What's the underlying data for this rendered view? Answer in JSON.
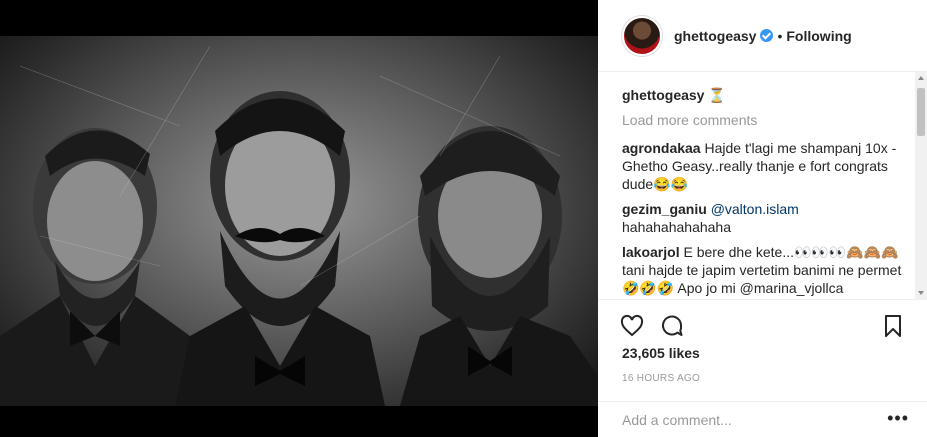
{
  "post": {
    "author": "ghettogeasy",
    "follow_status": "Following",
    "separator": "•",
    "image_label": ""
  },
  "comments": {
    "caption": {
      "user": "ghettogeasy",
      "text": "⏳"
    },
    "load_more": "Load more comments",
    "items": [
      {
        "user": "agrondakaa",
        "text": "Hajde t'lagi me shampanj 10x - Ghetho Geasy..really thanje e fort congrats dude😂😂"
      },
      {
        "user": "gezim_ganiu",
        "mention": "@valton.islam",
        "text": "hahahahahahaha"
      },
      {
        "user": "lakoarjol",
        "text": "E bere dhe kete...👀👀👀🙈🙈🙈 tani hajde te japim vertetim banimi ne permet 🤣🤣🤣 Apo jo mi @marina_vjollca"
      }
    ]
  },
  "stats": {
    "likes": "23,605 likes",
    "time": "16 HOURS AGO"
  },
  "compose": {
    "placeholder": "Add a comment...",
    "more_label": "•••"
  },
  "icons": {
    "like": "heart-icon",
    "comment": "comment-icon",
    "save": "bookmark-icon"
  }
}
